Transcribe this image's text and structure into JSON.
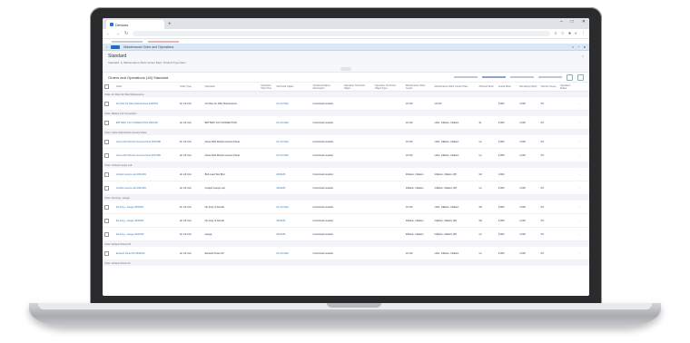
{
  "browser": {
    "tab_title": "Devices",
    "new_tab": "+",
    "controls": [
      "–",
      "□",
      "✕"
    ]
  },
  "app": {
    "shell_title": "Maintenance Order and Operations"
  },
  "header": {
    "title": "Standard",
    "subtitle": "Standard: 6, Maintenance Work Center Dam; Product Type Dam"
  },
  "toolbar": {
    "title": "Orders and Operations (18) Standard"
  },
  "columns": [
    "Order",
    "Order Type",
    "Operation",
    "Operation Short Text",
    "Technical Object",
    "Technical Object Description",
    "Operation Technical Object",
    "Operation Technical Object Type",
    "Maintenance Work Center",
    "Maintenance Work Center Plant",
    "Planned Work",
    "Actual Work",
    "Remaining Work",
    "Planner Group",
    "Operation Status"
  ],
  "groups": [
    {
      "label": "Order: Air Filter Air Filter Maintenance",
      "rows": [
        {
          "order": "Air Filter Air Filter Maintenance 4002154",
          "type": "Air Lift Unit",
          "op": "Air Filter Air Filter Maintenance",
          "obj": "Air Lift Filter",
          "col6": "Functional Location",
          "mwc": "LF-IS3",
          "plant": "LF-IS3",
          "pw": "",
          "aw": "3,000",
          "rw": "1,000",
          "pg": "FS"
        }
      ]
    },
    {
      "label": "Order: Battery 12V Connection",
      "rows": [
        {
          "order": "BATTERY 12V CONNECTION 4002153",
          "type": "Air Lift Unit",
          "op": "BATTERY 12V CONNECTION",
          "obj": "Air Lift Filter",
          "col6": "Functional Location",
          "mwc": "LF-IS3",
          "plant": "Lifter, Inflation, Inflation",
          "pw": "IH",
          "aw": "3,000",
          "rw": "1,000",
          "pg": "FS"
        }
      ]
    },
    {
      "label": "Order: Close Web Monitor Access Panel",
      "rows": [
        {
          "order": "Close Web Monitor Access Panel 4002188",
          "type": "Air Lift Unit",
          "op": "Close Web Monitor Access Panel",
          "obj": "Air Lift Filter",
          "col6": "Functional Location",
          "mwc": "LF-IS3",
          "plant": "Lifter, Inflation, Inflation",
          "pw": "L2",
          "aw": "2,000",
          "rw": "1,000",
          "pg": "FS"
        },
        {
          "order": "Close Web Monitor Access Panel 4002189",
          "type": "Air Lift Unit",
          "op": "Close Web Monitor Access Panel",
          "obj": "Air Lift Filter",
          "col6": "Functional Location",
          "mwc": "LF-IS3",
          "plant": "Lifter, Inflation, Inflation",
          "pw": "L2",
          "aw": "2,000",
          "rw": "1,000",
          "pg": "FS"
        }
      ]
    },
    {
      "label": "Order: Cockpit Lamps Left",
      "rows": [
        {
          "order": "Cockpit Lamps Left 4002183",
          "type": "Air Lift Unit",
          "op": "Bird Lead Test Bird",
          "obj": "4002183",
          "col6": "Functional Location",
          "mwc": "Inflation, Inflation",
          "plant": "Inflation, Inflation (IP)",
          "pw": "D2",
          "aw": "3,000",
          "rw": "",
          "pg": ""
        },
        {
          "order": "Cockpit Lamps Left 4002184",
          "type": "Air Lift Unit",
          "op": "Cockpit Lamps Left",
          "obj": "4002184",
          "col6": "Functional Location",
          "mwc": "Inflation, Inflation",
          "plant": "Inflation, Inflation (IP)",
          "pw": "L2",
          "aw": "3,000",
          "rw": "1,000",
          "pg": "FS"
        }
      ]
    },
    {
      "label": "Order: De-Icing - Gauge",
      "rows": [
        {
          "order": "De-Icing - Gauge 4002181",
          "type": "Air Lift Unit",
          "op": "De-Icing of Aircraft",
          "obj": "Air Lift Filter",
          "col6": "Functional Location",
          "mwc": "LF-IS3",
          "plant": "Lifter, Inflation, Inflation",
          "pw": "D2",
          "aw": "3,000",
          "rw": "1,000",
          "pg": "FS"
        },
        {
          "order": "De-Icing - Gauge 4002182",
          "type": "Air Lift Unit",
          "op": "De-Icing of Aircraft",
          "obj": "4002182",
          "col6": "Functional Location",
          "mwc": "Inflation, Inflation",
          "plant": "Inflation, Inflation (IP)",
          "pw": "D2",
          "aw": "3,000",
          "rw": "1,000",
          "pg": "FS"
        },
        {
          "order": "De-Icing - Gauge 4002185",
          "type": "Air Lift Unit",
          "op": "Gauge",
          "obj": "4002185",
          "col6": "Functional Location",
          "mwc": "Inflation, Inflation",
          "plant": "Inflation, Inflation (IP)",
          "pw": "L2",
          "aw": "3,000",
          "rw": "1,000",
          "pg": "FS"
        }
      ]
    },
    {
      "label": "Order: Exhaust Panel Off",
      "rows": [
        {
          "order": "Exhaust Panel Off 4002190",
          "type": "Air Lift Unit",
          "op": "Exhaust Panel Off",
          "obj": "Air Lift Filter",
          "col6": "Functional Location",
          "mwc": "LF-IS3",
          "plant": "Lifter, Inflation, Inflation",
          "pw": "L2",
          "aw": "3,000",
          "rw": "1,000",
          "pg": "FS"
        }
      ]
    },
    {
      "label": "Order: Exhaust Panel On",
      "rows": []
    }
  ]
}
